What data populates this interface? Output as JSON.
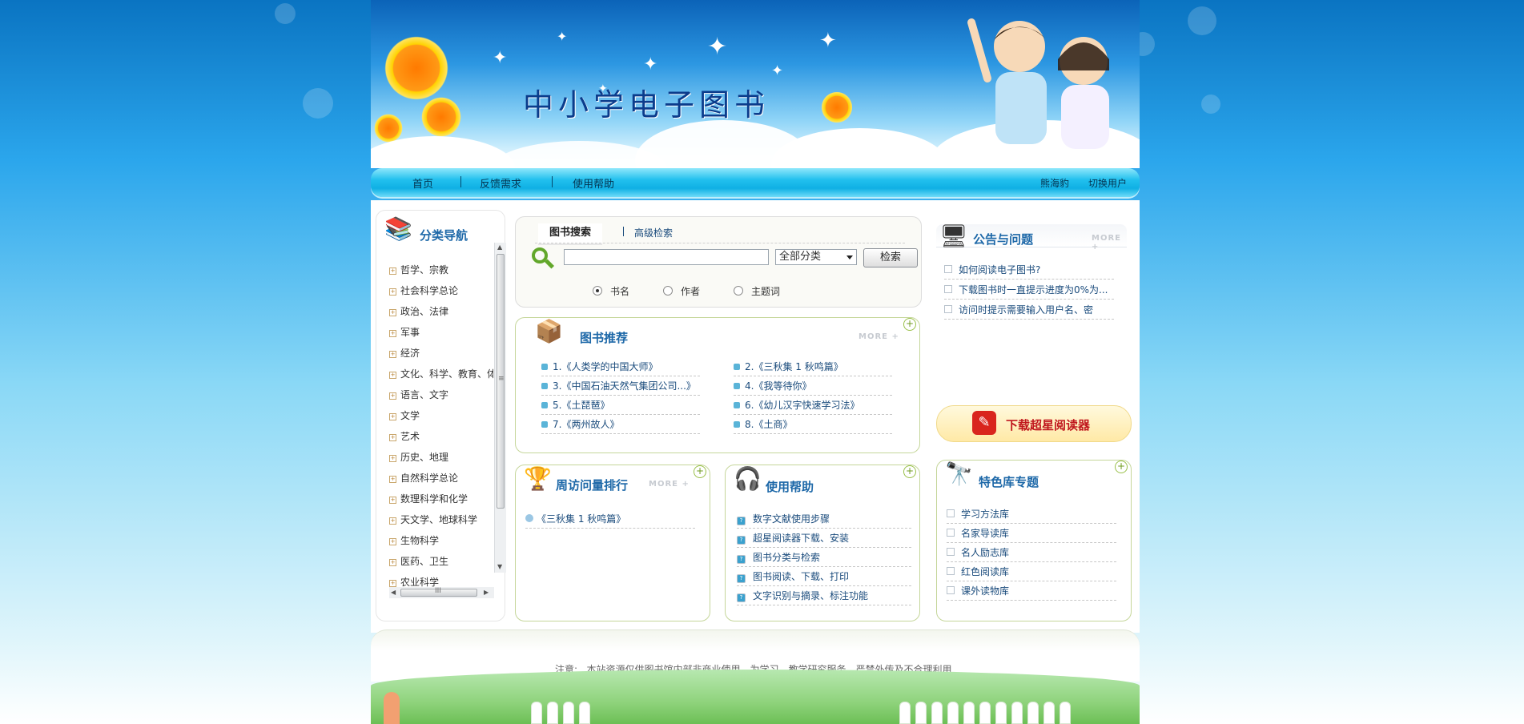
{
  "colors": {
    "brand_blue": "#1d68a8",
    "nav_bg": "#22c0ee",
    "box_border": "#c5d69a"
  },
  "banner": {
    "title": "中小学电子图书"
  },
  "nav": {
    "items": [
      "首页",
      "反馈需求",
      "使用帮助"
    ],
    "user_label": "熊海豹",
    "switch_user": "切换用户"
  },
  "sidebar": {
    "title": "分类导航",
    "items": [
      "哲学、宗教",
      "社会科学总论",
      "政治、法律",
      "军事",
      "经济",
      "文化、科学、教育、体",
      "语言、文字",
      "文学",
      "艺术",
      "历史、地理",
      "自然科学总论",
      "数理科学和化学",
      "天文学、地球科学",
      "生物科学",
      "医药、卫生",
      "农业科学"
    ],
    "scroll_h_label": "III",
    "scroll_v_label": "≡"
  },
  "search": {
    "tab_active": "图书搜索",
    "tab_advanced": "高级检索",
    "input_value": "",
    "category_selected": "全部分类",
    "button": "检索",
    "radios": [
      {
        "label": "书名",
        "checked": true
      },
      {
        "label": "作者",
        "checked": false
      },
      {
        "label": "主题词",
        "checked": false
      }
    ]
  },
  "recommend": {
    "title": "图书推荐",
    "more": "MORE +",
    "items": [
      "1.《人类学的中国大师》",
      "2.《三秋集 1 秋鸣篇》",
      "3.《中国石油天然气集团公司...》",
      "4.《我等待你》",
      "5.《土琵琶》",
      "6.《幼儿汉字快速学习法》",
      "7.《两州故人》",
      "8.《土商》"
    ]
  },
  "announce": {
    "title": "公告与问题",
    "more": "MORE +",
    "items": [
      "如何阅读电子图书?",
      "下载图书时一直提示进度为0%为...",
      "访问时提示需要输入用户名、密"
    ]
  },
  "download": {
    "label": "下载超星阅读器"
  },
  "weekly": {
    "title": "周访问量排行",
    "more": "MORE +",
    "items": [
      "《三秋集 1 秋鸣篇》"
    ]
  },
  "help": {
    "title": "使用帮助",
    "items": [
      "数字文献使用步骤",
      "超星阅读器下载、安装",
      "图书分类与检索",
      "图书阅读、下载、打印",
      "文字识别与摘录、标注功能"
    ]
  },
  "special": {
    "title": "特色库专题",
    "items": [
      "学习方法库",
      "名家导读库",
      "名人励志库",
      "红色阅读库",
      "课外读物库"
    ]
  },
  "footer": {
    "notice_label": "注意:",
    "notice_text": "本站资源仅供图书馆内部非商业使用，为学习、教学研究服务，严禁外传及不合理利用"
  },
  "icons": {
    "search": "magnifier-icon",
    "plus": "plus-circle-icon",
    "radio": "radio-icon"
  }
}
